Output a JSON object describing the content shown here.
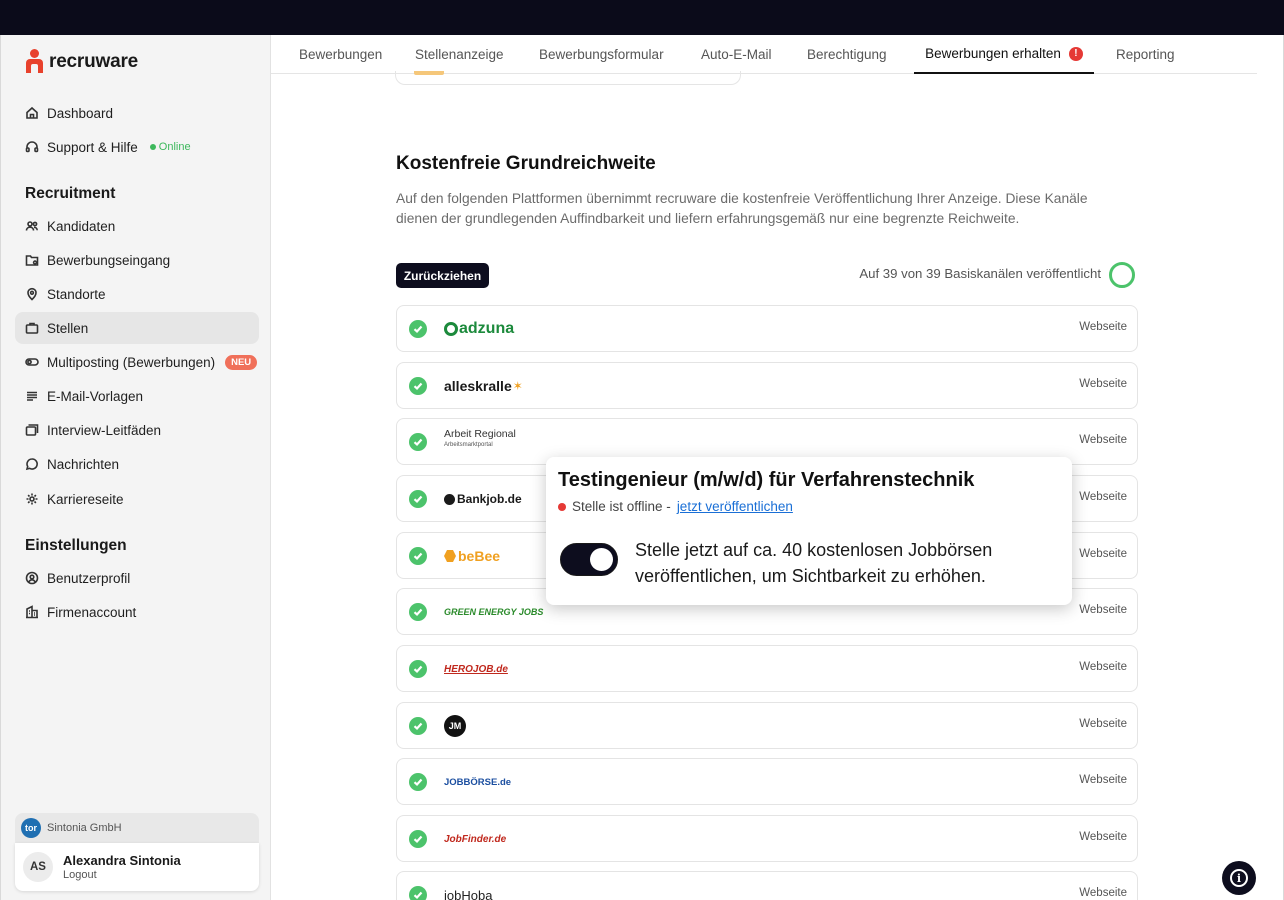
{
  "brand": {
    "name": "recruware",
    "color": "#e8412c"
  },
  "sidebar": {
    "dashboard": "Dashboard",
    "support": "Support & Hilfe",
    "online": "Online",
    "recruitment_title": "Recruitment",
    "items": [
      {
        "label": "Kandidaten",
        "icon": "users-icon"
      },
      {
        "label": "Bewerbungseingang",
        "icon": "inbox-folder-icon"
      },
      {
        "label": "Standorte",
        "icon": "location-pin-icon"
      },
      {
        "label": "Stellen",
        "icon": "briefcase-icon"
      },
      {
        "label": "Multiposting (Bewerbungen)",
        "icon": "toggle-icon",
        "badge": "NEU"
      },
      {
        "label": "E-Mail-Vorlagen",
        "icon": "lines-icon"
      },
      {
        "label": "Interview-Leitfäden",
        "icon": "windows-icon"
      },
      {
        "label": "Nachrichten",
        "icon": "chat-bubble-icon"
      },
      {
        "label": "Karriereseite",
        "icon": "gear-icon"
      }
    ],
    "settings_title": "Einstellungen",
    "settings": [
      {
        "label": "Benutzerprofil",
        "icon": "user-circle-icon"
      },
      {
        "label": "Firmenaccount",
        "icon": "building-icon"
      }
    ],
    "company": "Sintonia GmbH",
    "company_logo_text": "tor",
    "user": {
      "initials": "AS",
      "name": "Alexandra Sintonia",
      "logout": "Logout"
    }
  },
  "tabs": [
    {
      "label": "Bewerbungen"
    },
    {
      "label": "Stellenanzeige"
    },
    {
      "label": "Bewerbungsformular"
    },
    {
      "label": "Auto-E-Mail"
    },
    {
      "label": "Berechtigung"
    },
    {
      "label": "Bewerbungen erhalten",
      "alert": "!"
    },
    {
      "label": "Reporting"
    }
  ],
  "main": {
    "title": "Kostenfreie Grundreichweite",
    "description": "Auf den folgenden Plattformen übernimmt recruware die kostenfreie Veröffentlichung Ihrer Anzeige. Diese Kanäle dienen der grundlegenden Auffindbarkeit und liefern erfahrungsgemäß nur eine begrenzte Reichweite.",
    "withdraw_button": "Zurückziehen",
    "publish_status": "Auf 39 von 39 Basiskanälen veröffentlicht",
    "publish_progress": 1.0,
    "channels": [
      {
        "logo": "adzuna",
        "type": "Webseite"
      },
      {
        "logo": "alleskralle",
        "type": "Webseite"
      },
      {
        "logo": "Arbeit Regional",
        "logo_sub": "Arbeitsmarktportal",
        "type": "Webseite"
      },
      {
        "logo": "Bankjob.de",
        "type": "Webseite"
      },
      {
        "logo": "beBee",
        "type": "Webseite"
      },
      {
        "logo": "GREEN ENERGY JOBS",
        "type": "Webseite"
      },
      {
        "logo": "HEROJOB.de",
        "type": "Webseite"
      },
      {
        "logo": "JM",
        "type": "Webseite"
      },
      {
        "logo": "JOBBÖRSE.de",
        "type": "Webseite"
      },
      {
        "logo": "JobFinder.de",
        "type": "Webseite"
      },
      {
        "logo": "jobHoba",
        "type": "Webseite"
      }
    ]
  },
  "popup": {
    "title": "Testingenieur (m/w/d) für Verfahrenstechnik",
    "status": "Stelle ist offline -",
    "link": "jetzt veröffentlichen",
    "toggle_on": true,
    "text": "Stelle jetzt auf ca. 40 kostenlosen Jobbörsen veröffentlichen, um  Sichtbarkeit zu erhöhen."
  }
}
